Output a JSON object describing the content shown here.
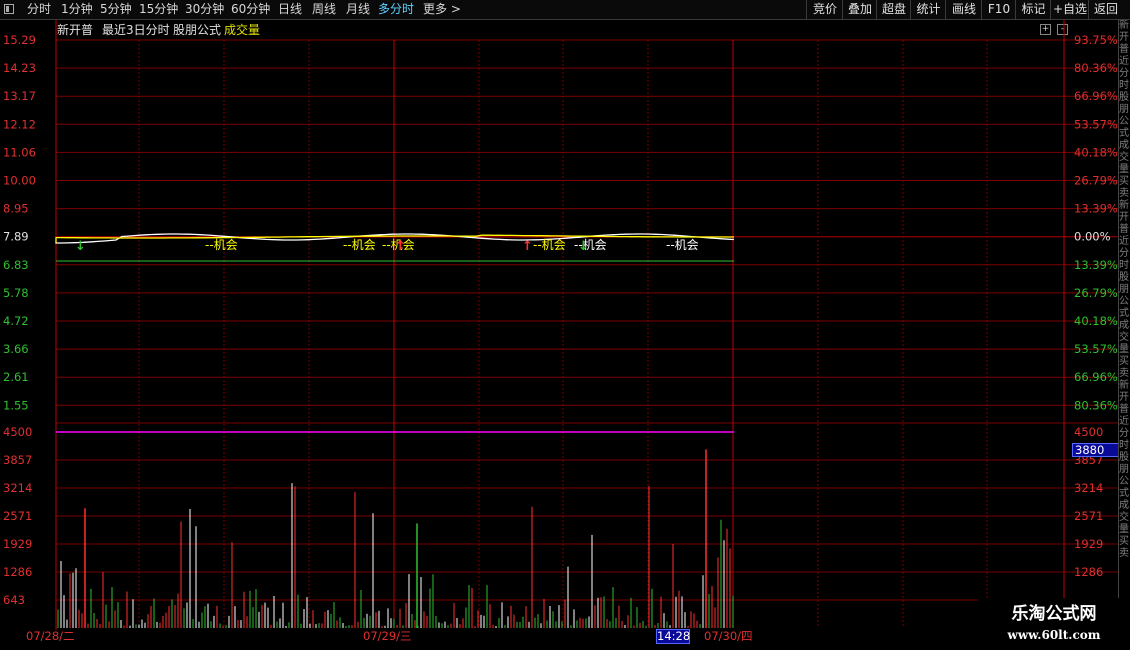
{
  "toolbar": {
    "tabs": [
      "分时",
      "1分钟",
      "5分钟",
      "15分钟",
      "30分钟",
      "60分钟",
      "日线",
      "周线",
      "月线",
      "多分时",
      "更多 >"
    ],
    "active_tab": "多分时",
    "right_buttons": [
      "竞价",
      "叠加",
      "超盘",
      "统计",
      "画线",
      "F10",
      "标记",
      "+自选",
      "返回"
    ]
  },
  "title": {
    "stock_name": "新开普",
    "period": "最近3日分时",
    "formula": "股朋公式",
    "indicator": "成交量"
  },
  "price_axis": {
    "labels": [
      "15.29",
      "14.23",
      "13.17",
      "12.12",
      "11.06",
      "10.00",
      "8.95",
      "7.89",
      "6.83",
      "5.78",
      "4.72",
      "3.66",
      "2.61",
      "1.55"
    ],
    "pct_labels": [
      "93.75%",
      "80.36%",
      "66.96%",
      "53.57%",
      "40.18%",
      "26.79%",
      "13.39%",
      "0.00%",
      "13.39%",
      "26.79%",
      "40.18%",
      "53.57%",
      "66.96%",
      "80.36%"
    ],
    "pre_close": "7.89"
  },
  "volume_axis": {
    "labels": [
      "4500",
      "3857",
      "3214",
      "2571",
      "1929",
      "1286",
      "643"
    ],
    "current": "3880"
  },
  "x_axis": {
    "dates": [
      "07/28/二",
      "07/29/三",
      "07/30/四"
    ],
    "current_time": "14:28"
  },
  "signals": {
    "text": "机会"
  },
  "colors": {
    "up": "#ff3030",
    "down": "#30c030",
    "price_line": "#ffffff",
    "avg_line": "#ffff00",
    "grid": "#7a0000",
    "accent": "#5fd0ff"
  },
  "chart_data": {
    "type": "bar",
    "title": "成交量",
    "categories": [
      "07/28/二",
      "07/29/三",
      "07/30/四"
    ],
    "series": [
      {
        "name": "成交量",
        "values": [
          2750,
          2400,
          4100
        ]
      }
    ],
    "ylim": [
      0,
      4500
    ]
  },
  "watermark": {
    "line1": "乐淘公式网",
    "line2": "www.60lt.com"
  },
  "right_panel_chars": [
    "新",
    "开",
    "普",
    "近",
    "分",
    "时",
    "股",
    "朋",
    "公",
    "式",
    "成",
    "交",
    "量",
    "买",
    "卖"
  ]
}
